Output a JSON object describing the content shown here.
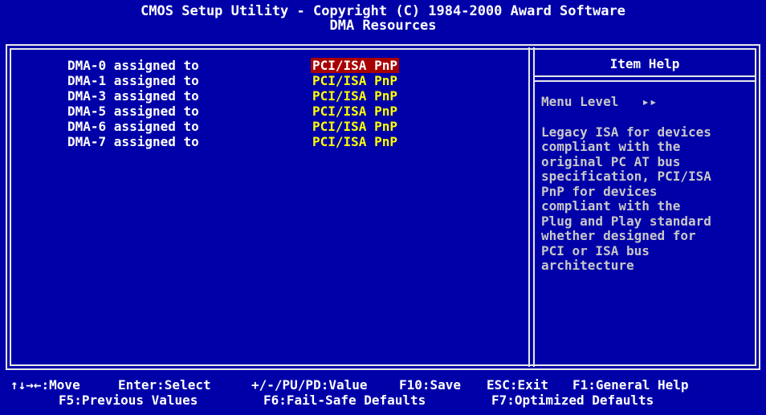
{
  "header": {
    "line1": "CMOS Setup Utility - Copyright (C) 1984-2000 Award Software",
    "line2": "DMA Resources"
  },
  "items": [
    {
      "label": "DMA-0 assigned to",
      "value": "PCI/ISA PnP",
      "selected": true
    },
    {
      "label": "DMA-1 assigned to",
      "value": "PCI/ISA PnP",
      "selected": false
    },
    {
      "label": "DMA-3 assigned to",
      "value": "PCI/ISA PnP",
      "selected": false
    },
    {
      "label": "DMA-5 assigned to",
      "value": "PCI/ISA PnP",
      "selected": false
    },
    {
      "label": "DMA-6 assigned to",
      "value": "PCI/ISA PnP",
      "selected": false
    },
    {
      "label": "DMA-7 assigned to",
      "value": "PCI/ISA PnP",
      "selected": false
    }
  ],
  "help": {
    "title": "Item Help",
    "menu_level": "Menu Level   ▸▸",
    "lines": [
      "Legacy ISA for devices",
      "compliant with the",
      "original PC AT bus",
      "specification, PCI/ISA",
      "PnP for devices",
      "compliant with the",
      "Plug and Play standard",
      "whether designed for",
      "PCI or ISA bus",
      "architecture"
    ]
  },
  "footer": {
    "move": "↑↓→←:Move",
    "enter": "Enter:Select",
    "value": "+/-/PU/PD:Value",
    "save": "F10:Save",
    "esc": "ESC:Exit",
    "f1": "F1:General Help",
    "f5": "F5:Previous Values",
    "f6": "F6:Fail-Safe Defaults",
    "f7": "F7:Optimized Defaults"
  }
}
